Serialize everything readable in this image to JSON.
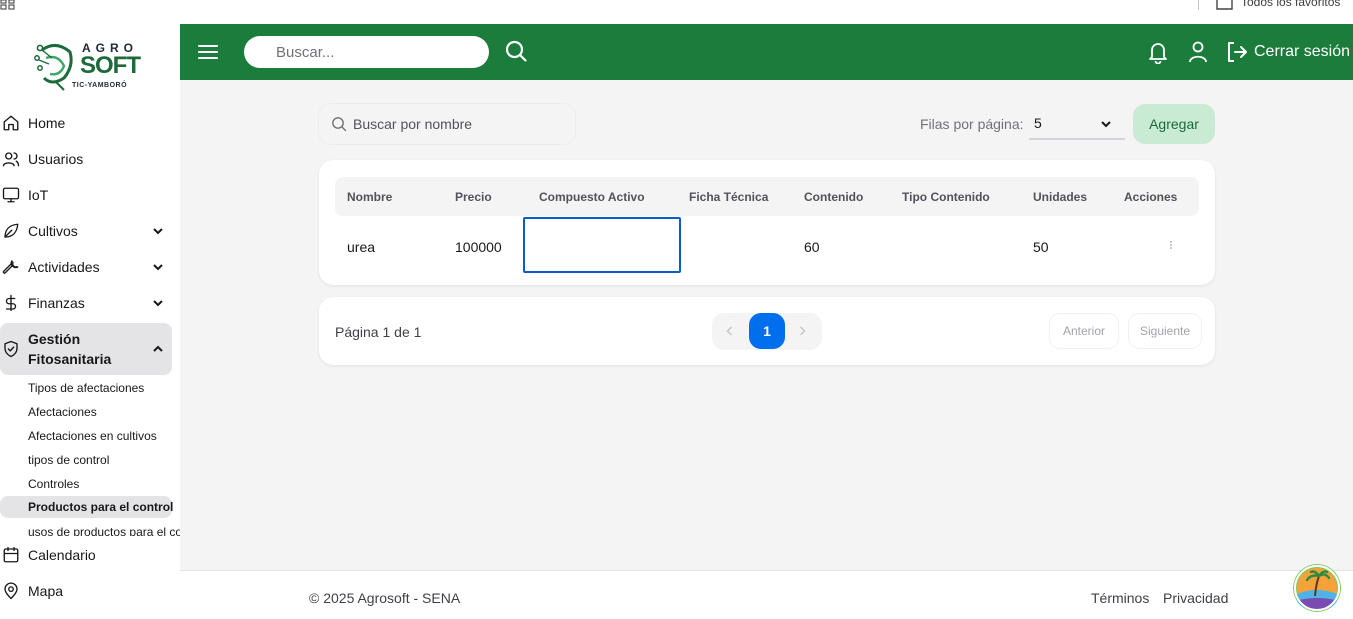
{
  "browser": {
    "bookmarks_label": "Todos los favoritos"
  },
  "sidebar": {
    "logo": {
      "top": "AGRO",
      "main": "SOFT",
      "bottom": "TIC-YAMBORÓ"
    },
    "items": [
      {
        "label": "Home",
        "icon": "home-icon"
      },
      {
        "label": "Usuarios",
        "icon": "users-icon"
      },
      {
        "label": "IoT",
        "icon": "monitor-icon"
      },
      {
        "label": "Cultivos",
        "icon": "leaf-icon"
      },
      {
        "label": "Actividades",
        "icon": "wrench-icon"
      },
      {
        "label": "Finanzas",
        "icon": "dollar-icon"
      },
      {
        "label": "Gestión Fitosanitaria",
        "icon": "shield-icon"
      },
      {
        "label": "Calendario",
        "icon": "calendar-icon"
      },
      {
        "label": "Mapa",
        "icon": "map-pin-icon"
      }
    ],
    "subitems": [
      {
        "label": "Tipos de afectaciones"
      },
      {
        "label": "Afectaciones"
      },
      {
        "label": "Afectaciones en cultivos"
      },
      {
        "label": "tipos de control"
      },
      {
        "label": "Controles"
      },
      {
        "label": "Productos para el control"
      },
      {
        "label": "usos de productos para el control"
      }
    ]
  },
  "header": {
    "search_placeholder": "Buscar...",
    "logout_label": "Cerrar sesión"
  },
  "toolbar": {
    "search_placeholder": "Buscar por nombre",
    "rows_per_page_label": "Filas por página:",
    "rows_per_page_value": "5",
    "add_label": "Agregar"
  },
  "table": {
    "columns": [
      "Nombre",
      "Precio",
      "Compuesto Activo",
      "Ficha Técnica",
      "Contenido",
      "Tipo Contenido",
      "Unidades",
      "Acciones"
    ],
    "rows": [
      {
        "nombre": "urea",
        "precio": "100000",
        "compuesto_activo": "",
        "ficha_tecnica": "",
        "contenido": "60",
        "tipo_contenido": "",
        "unidades": "50"
      }
    ]
  },
  "pagination": {
    "summary": "Página 1 de 1",
    "current_page": "1",
    "prev_label": "Anterior",
    "next_label": "Siguiente"
  },
  "footer": {
    "copyright": "© 2025 Agrosoft - SENA",
    "terms": "Términos",
    "privacy": "Privacidad"
  },
  "colors": {
    "brand_green": "#1b7c3c",
    "primary_blue": "#006fee",
    "add_button_bg": "#c9ebd3"
  }
}
